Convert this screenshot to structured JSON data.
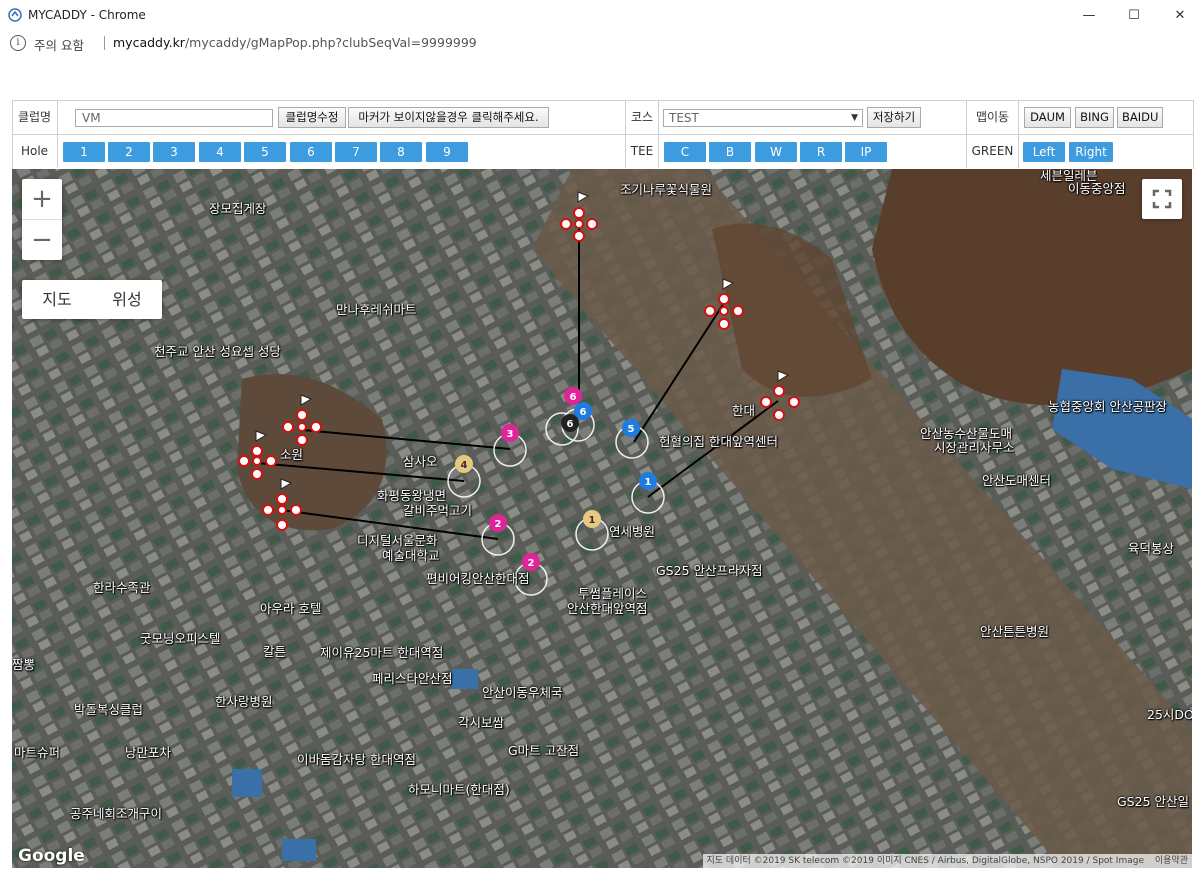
{
  "window": {
    "title": "MYCADDY - Chrome",
    "minimize": "—",
    "maximize": "☐",
    "close": "✕"
  },
  "address": {
    "security": "주의 요함",
    "url_domain": "mycaddy.kr",
    "url_path": "/mycaddy/gMapPop.php?clubSeqVal=9999999"
  },
  "toolbar": {
    "club_label": "클럽명",
    "club_value": "VM",
    "edit_club_button": "클럽명수정",
    "marker_help_button": "마커가 보이지않을경우 클릭해주세요.",
    "course_label": "코스",
    "course_selected": "TEST",
    "save_button": "저장하기",
    "map_move_label": "맵이동",
    "map_buttons": [
      "DAUM",
      "BING",
      "BAIDU"
    ],
    "hole_label": "Hole",
    "holes": [
      "1",
      "2",
      "3",
      "4",
      "5",
      "6",
      "7",
      "8",
      "9"
    ],
    "tee_label": "TEE",
    "tees": [
      "C",
      "B",
      "W",
      "R",
      "IP"
    ],
    "green_label": "GREEN",
    "greens": [
      "Left",
      "Right"
    ]
  },
  "map": {
    "zoom_in": "+",
    "zoom_out": "−",
    "map_type_map": "지도",
    "map_type_satellite": "위성",
    "google_logo": "Google",
    "attribution": "지도 데이터 ©2019 SK telecom ©2019 이미지 CNES / Airbus, DigitalGlobe, NSPO 2019 / Spot Image",
    "terms": "이용약관",
    "labels": [
      "조기나루꽃식물원",
      "장모집게장",
      "만나후레쉬마트",
      "천주교 안산 성요셉 성당",
      "소원",
      "삼사오",
      "화평동왕냉면",
      "갈비주먹고기",
      "헌혈의집 한대앞역센터",
      "한대",
      "디지털서울문화",
      "예술대학교",
      "연세병원",
      "GS25 안산프라자점",
      "편비어킹안산한대점",
      "투썸플레이스",
      "안산한대앞역점",
      "한라수족관",
      "아우라 호텔",
      "굿모닝오피스텔",
      "칼튼",
      "제이유25마트 한대역점",
      "페리스타안산점",
      "한사랑병원",
      "안산이동우체국",
      "박돌복싱클럽",
      "각시보쌈",
      "마트슈퍼",
      "낭만포차",
      "이바돔감자탕 한대역점",
      "G마트 고잔점",
      "하모니마트(한대점)",
      "공주네회조개구이",
      "짬뽕",
      "농협중앙회 안산공판장",
      "안산농수산물도매",
      "시장관리사무소",
      "안산도매센터",
      "육덕봉상",
      "안산튼튼병원",
      "25시DO",
      "GS25 안산일",
      "세븐일레븐",
      "이동중앙점"
    ],
    "pins": [
      "1",
      "2",
      "3",
      "4",
      "5",
      "6",
      "1",
      "2",
      "3",
      "4",
      "5",
      "6",
      "6"
    ]
  }
}
